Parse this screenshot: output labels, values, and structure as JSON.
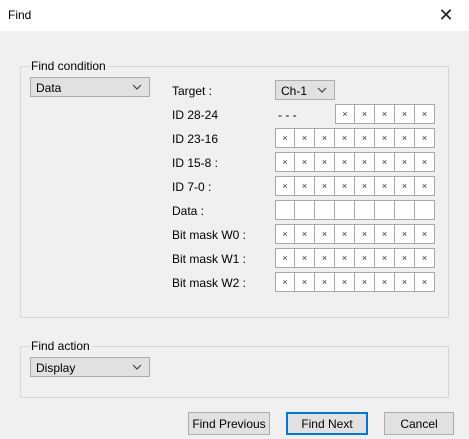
{
  "window": {
    "title": "Find",
    "close_icon": "close-icon"
  },
  "find_condition": {
    "label": "Find condition",
    "type_select": {
      "value": "Data"
    },
    "target_label": "Target :",
    "target_select": {
      "value": "Ch-1"
    },
    "rows": [
      {
        "label": "ID 28-24",
        "prefix": "- - -",
        "cells": [
          "×",
          "×",
          "×",
          "×",
          "×"
        ]
      },
      {
        "label": "ID 23-16",
        "cells": [
          "×",
          "×",
          "×",
          "×",
          "×",
          "×",
          "×",
          "×"
        ]
      },
      {
        "label": "ID 15-8 :",
        "cells": [
          "×",
          "×",
          "×",
          "×",
          "×",
          "×",
          "×",
          "×"
        ]
      },
      {
        "label": "ID 7-0 :",
        "cells": [
          "×",
          "×",
          "×",
          "×",
          "×",
          "×",
          "×",
          "×"
        ]
      },
      {
        "label": "Data :",
        "cells": [
          "",
          "",
          "",
          "",
          "",
          "",
          "",
          ""
        ]
      },
      {
        "label": "Bit mask W0 :",
        "cells": [
          "×",
          "×",
          "×",
          "×",
          "×",
          "×",
          "×",
          "×"
        ]
      },
      {
        "label": "Bit mask W1 :",
        "cells": [
          "×",
          "×",
          "×",
          "×",
          "×",
          "×",
          "×",
          "×"
        ]
      },
      {
        "label": "Bit mask W2 :",
        "cells": [
          "×",
          "×",
          "×",
          "×",
          "×",
          "×",
          "×",
          "×"
        ]
      }
    ]
  },
  "find_action": {
    "label": "Find action",
    "action_select": {
      "value": "Display"
    }
  },
  "buttons": {
    "find_previous": "Find Previous",
    "find_next": "Find Next",
    "cancel": "Cancel"
  }
}
